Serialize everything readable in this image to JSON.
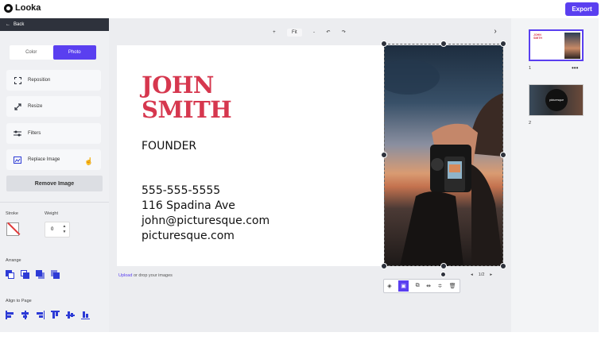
{
  "app": {
    "logo": "Looka",
    "export_label": "Export"
  },
  "left_panel": {
    "back_label": "Back",
    "tabs": [
      {
        "label": "Color"
      },
      {
        "label": "Photo"
      }
    ],
    "tools": [
      {
        "label": "Reposition",
        "icon": "reposition-icon"
      },
      {
        "label": "Resize",
        "icon": "resize-icon"
      },
      {
        "label": "Filters",
        "icon": "filters-icon"
      },
      {
        "label": "Replace Image",
        "icon": "replace-image-icon"
      }
    ],
    "remove_label": "Remove Image",
    "stroke_label": "Stroke",
    "weight_label": "Weight",
    "weight_value": "0",
    "arrange_label": "Arrange",
    "align_label": "Align to Page"
  },
  "toolbar": {
    "plus": "+",
    "fit": "Fit",
    "minus": "-",
    "undo": "↶",
    "redo": "↷"
  },
  "card": {
    "name_line1": "JOHN",
    "name_line2": "SMITH",
    "role": "FOUNDER",
    "phone": "555-555-5555",
    "address": "116 Spadina Ave",
    "email": "john@picturesque.com",
    "website": "picturesque.com",
    "accent_color": "#d6374e"
  },
  "upload": {
    "link": "Upload",
    "rest": " or drop your images"
  },
  "pager": {
    "prev": "◂",
    "text": "1/2",
    "next": "▸"
  },
  "pages": [
    {
      "number": "1",
      "menu": "•••",
      "mini_name": "JOHN SMITH"
    },
    {
      "number": "2",
      "mini_text": "picturesque"
    }
  ],
  "colors": {
    "brand": "#5a3ff0",
    "dark": "#2e323c"
  }
}
